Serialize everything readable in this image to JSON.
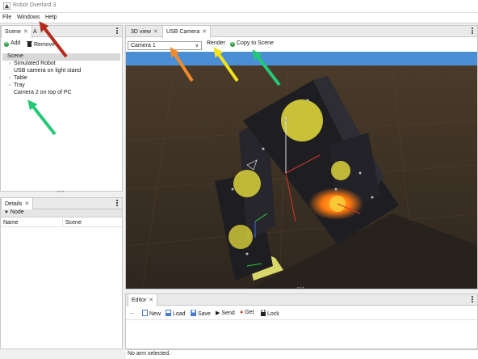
{
  "window": {
    "title": "Robot Overlord 3"
  },
  "menu": {
    "items": [
      "File",
      "Windows",
      "Help"
    ]
  },
  "scene_panel": {
    "tabs": [
      {
        "label": "Scene"
      },
      {
        "label": "A"
      }
    ],
    "close": "✕",
    "add_label": "Add",
    "remove_label": "Remove",
    "tree": [
      {
        "label": "Scene",
        "caret": "",
        "selected": true
      },
      {
        "label": "Simulated Robot",
        "caret": "›"
      },
      {
        "label": "USB camera on light stand",
        "caret": ""
      },
      {
        "label": "Table",
        "caret": "›"
      },
      {
        "label": "Tray",
        "caret": "›"
      },
      {
        "label": "Camera 2 on top of PC",
        "caret": ""
      }
    ]
  },
  "details_panel": {
    "tab": "Details",
    "section": "Node",
    "rows": [
      {
        "key": "Name",
        "value": "Scene"
      }
    ]
  },
  "view_panel": {
    "tabs": [
      {
        "label": "3D view"
      },
      {
        "label": "USB Camera"
      }
    ],
    "camera_select": "Camera 1",
    "render_label": "Render",
    "copy_label": "Copy to Scene"
  },
  "editor_panel": {
    "tab": "Editor",
    "toolbar": {
      "more": "...",
      "new": "New",
      "load": "Load",
      "save": "Save",
      "send": "Send",
      "get": "Get",
      "lock": "Lock"
    }
  },
  "status_bar": {
    "text": "No arm selected."
  },
  "colors": {
    "sky": "#4a8fd6",
    "floor": "#3b3024",
    "robot_panel": "#1e1e22",
    "disc_yellow": "#e7de3c",
    "glow_orange": "#ff8a10",
    "green_dot": "#2ea043",
    "arrow_red": "#b42a1c",
    "arrow_orange": "#f08a2c",
    "arrow_yellow": "#f2e21a",
    "arrow_green": "#25c875"
  }
}
